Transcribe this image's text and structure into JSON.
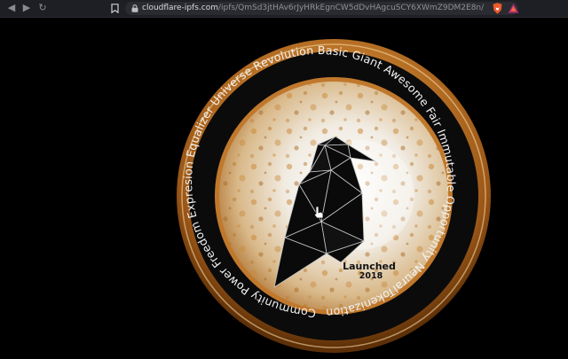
{
  "browser": {
    "url_host": "cloudflare-ipfs.com",
    "url_path": "/ipfs/QmSd3jtHAv6rJyHRkEgnCW5dDvHAgcuSCY6XWmZ9DM2E8n/",
    "icons": {
      "back": "chevron-left-icon",
      "forward": "chevron-right-icon",
      "reload": "reload-icon",
      "bookmark": "bookmark-icon",
      "lock": "lock-icon",
      "brave": "brave-shield-icon",
      "rewards": "brave-rewards-icon"
    }
  },
  "coin": {
    "ring_text": "Community Power Freedom Expresion Equalizer Universe Revolution Basic Giant Awesome Fair Immutable Opportunity NeuralTokenization Truth Decentralization Secure",
    "launched_label": "Launched",
    "launched_year": "2018",
    "colors": {
      "gold": "#c8802e",
      "gold_dark": "#7a4510",
      "ring_black": "#0b0b0b",
      "face": "#efe8dc"
    }
  }
}
